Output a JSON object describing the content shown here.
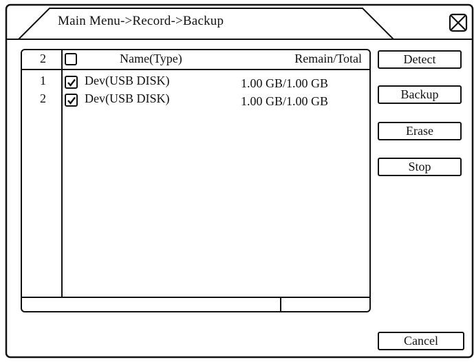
{
  "window": {
    "title": "Main Menu->Record->Backup"
  },
  "table": {
    "count_header": "2",
    "name_header": "Name(Type)",
    "remain_header": "Remain/Total",
    "select_all_checked": false,
    "rows": [
      {
        "index": "1",
        "checked": true,
        "name": "Dev(USB DISK)",
        "capacity": "1.00 GB/1.00 GB"
      },
      {
        "index": "2",
        "checked": true,
        "name": "Dev(USB DISK)",
        "capacity": "1.00 GB/1.00 GB"
      }
    ]
  },
  "buttons": {
    "detect": "Detect",
    "backup": "Backup",
    "erase": "Erase",
    "stop": "Stop",
    "cancel": "Cancel"
  },
  "icons": {
    "close": "close-x-box-icon",
    "check": "checkmark-icon"
  }
}
